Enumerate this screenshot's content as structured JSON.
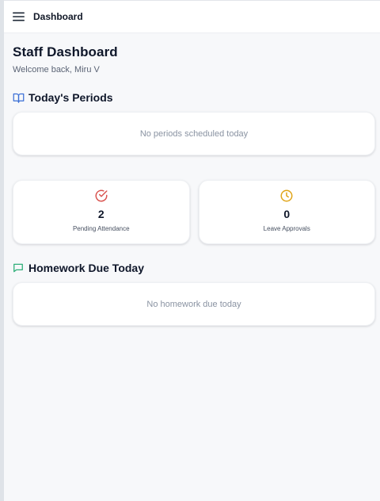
{
  "header": {
    "title": "Dashboard"
  },
  "page": {
    "title": "Staff Dashboard",
    "welcome": "Welcome back, Miru V"
  },
  "periods": {
    "title": "Today's Periods",
    "empty_text": "No periods scheduled today"
  },
  "stats": [
    {
      "value": "2",
      "label": "Pending Attendance",
      "icon": "check-circle-icon",
      "color": "#d9534f"
    },
    {
      "value": "0",
      "label": "Leave Approvals",
      "icon": "clock-icon",
      "color": "#e0a51a"
    }
  ],
  "homework": {
    "title": "Homework Due Today",
    "empty_text": "No homework due today"
  },
  "colors": {
    "book_icon": "#3b6fd6",
    "chat_icon": "#2eae78"
  }
}
